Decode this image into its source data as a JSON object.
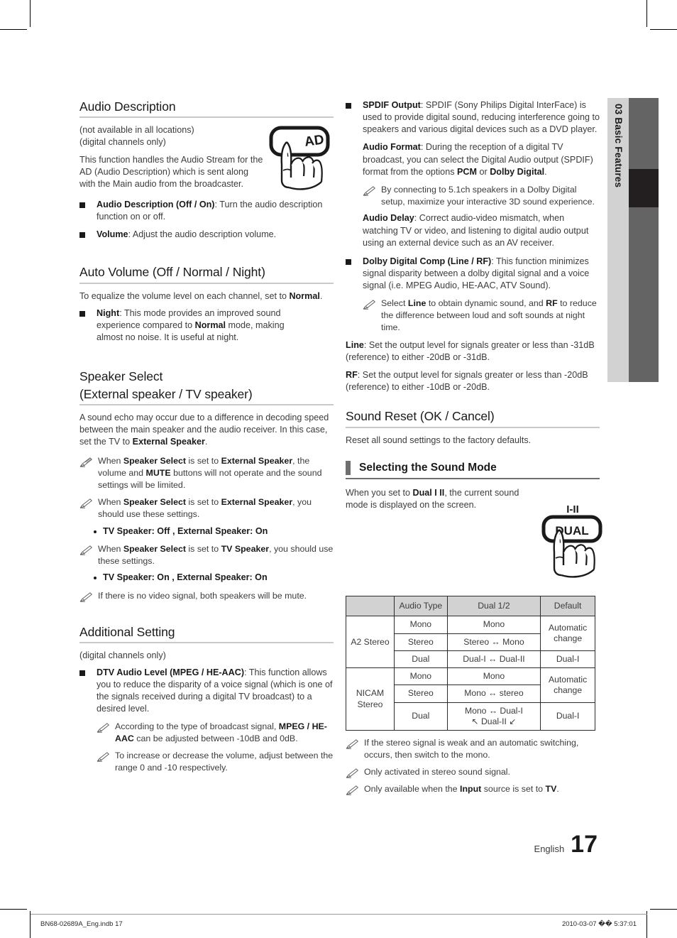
{
  "side_tab": {
    "label": "03  Basic Features"
  },
  "left_column": {
    "audio_description": {
      "heading": "Audio Description",
      "intro_line1": "(not available in all locations)",
      "intro_line2": "(digital channels only)",
      "paragraph": "This function handles the Audio Stream for the AD (Audio Description) which is sent along with the Main audio from the broadcaster.",
      "key_icon_label": "AD",
      "bullets": [
        {
          "bold": "Audio Description (Off / On)",
          "rest": ": Turn the audio description function on or off."
        },
        {
          "bold": "Volume",
          "rest": ": Adjust the audio description volume."
        }
      ]
    },
    "auto_volume": {
      "heading": "Auto Volume (Off / Normal / Night)",
      "intro_pre": "To equalize the volume level on each channel, set to ",
      "intro_bold": "Normal",
      "intro_post": ".",
      "bullet_bold": "Night",
      "bullet_part1": ": This mode provides an improved sound experience compared to ",
      "bullet_bold2": "Normal",
      "bullet_part2": " mode, making almost no noise. It is useful at night."
    },
    "speaker_select": {
      "heading_line1": "Speaker Select",
      "heading_line2": "(External speaker / TV speaker)",
      "paragraph_pre": "A sound echo may occur due to a difference in decoding speed between the main speaker and the audio receiver. In this case, set the TV to ",
      "paragraph_bold": "External Speaker",
      "paragraph_post": ".",
      "note1_a": "When ",
      "note1_b1": "Speaker Select",
      "note1_c": " is set to ",
      "note1_b2": "External Speaker",
      "note1_d": ", the volume and ",
      "note1_b3": "MUTE",
      "note1_e": " buttons will not operate and the sound settings will be limited.",
      "note2_a": "When ",
      "note2_b1": "Speaker Select",
      "note2_c": " is set to ",
      "note2_b2": "External Speaker",
      "note2_d": ", you should use these settings.",
      "dot1": "TV Speaker: Off , External Speaker: On",
      "note3_a": "When ",
      "note3_b1": "Speaker Select",
      "note3_c": " is set to ",
      "note3_b2": "TV Speaker",
      "note3_d": ", you should use these settings.",
      "dot2": "TV Speaker: On , External Speaker: On",
      "note4": "If there is no video signal, both speakers will be mute."
    },
    "additional_setting": {
      "heading": "Additional Setting",
      "intro": "(digital channels only)",
      "bullet_bold": "DTV Audio Level (MPEG / HE-AAC)",
      "bullet_rest": ": This function allows you to reduce the disparity of a voice signal (which is one of the signals received during a digital TV broadcast) to a desired level.",
      "note1_a": "According to the type of broadcast signal, ",
      "note1_b": "MPEG / HE-AAC",
      "note1_c": " can be adjusted between -10dB and 0dB.",
      "note2": "To increase or decrease the volume, adjust between the range 0 and -10 respectively."
    }
  },
  "right_column": {
    "spdif": {
      "bullet_bold": "SPDIF Output",
      "bullet_rest": ": SPDIF (Sony Philips Digital InterFace) is used to provide digital sound, reducing interference going to speakers and various digital devices such as a DVD player.",
      "audio_format_bold": "Audio Format",
      "audio_format_a": ": During the reception of a digital TV broadcast, you can select the Digital Audio output (SPDIF) format from the options ",
      "audio_format_b1": "PCM",
      "audio_format_b": " or ",
      "audio_format_b2": "Dolby Digital",
      "audio_format_c": ".",
      "note": "By connecting to 5.1ch speakers in a Dolby Digital setup, maximize your interactive 3D sound experience.",
      "audio_delay_bold": "Audio Delay",
      "audio_delay_rest": ": Correct audio-video mismatch, when watching TV or video, and listening to digital audio output using an external device such as an AV receiver."
    },
    "dolby_comp": {
      "bullet_bold": "Dolby Digital Comp (Line / RF)",
      "bullet_rest": ": This function minimizes signal disparity between a dolby digital signal and a voice signal (i.e. MPEG Audio, HE-AAC, ATV Sound).",
      "note_a": "Select ",
      "note_b1": "Line",
      "note_c": " to obtain dynamic sound, and ",
      "note_b2": "RF",
      "note_d": " to reduce the difference between loud and soft sounds at night time.",
      "line_bold": "Line",
      "line_rest": ": Set the output level for signals greater or less than -31dB (reference) to either -20dB or -31dB.",
      "rf_bold": "RF",
      "rf_rest": ": Set the output level for signals greater or less than -20dB (reference) to either -10dB or -20dB."
    },
    "sound_reset": {
      "heading": "Sound Reset (OK / Cancel)",
      "paragraph": "Reset all sound settings to the factory defaults."
    },
    "sound_mode": {
      "heading": "Selecting the Sound Mode",
      "paragraph_a": "When you set to ",
      "paragraph_b": "Dual I II",
      "paragraph_c": ", the current sound mode is displayed on the screen.",
      "key_icon_top": "I-II",
      "key_icon_label": "DUAL"
    },
    "table": {
      "headers": [
        "",
        "Audio Type",
        "Dual 1/2",
        "Default"
      ],
      "groups": [
        {
          "name": "A2 Stereo",
          "rows": [
            {
              "type": "Mono",
              "dual": "Mono",
              "default": "Automatic change",
              "default_span": 2
            },
            {
              "type": "Stereo",
              "dual": "Stereo ↔ Mono"
            },
            {
              "type": "Dual",
              "dual": "Dual-I ↔ Dual-II",
              "default": "Dual-I",
              "default_span": 1
            }
          ]
        },
        {
          "name": "NICAM Stereo",
          "rows": [
            {
              "type": "Mono",
              "dual": "Mono",
              "default": "Automatic change",
              "default_span": 2
            },
            {
              "type": "Stereo",
              "dual": "Mono ↔ stereo"
            },
            {
              "type": "Dual",
              "dual": "Mono ↔ Dual-I",
              "dual2": "↖ Dual-II ↙",
              "default": "Dual-I",
              "default_span": 1
            }
          ]
        }
      ]
    },
    "footnotes": [
      "If the stereo signal is weak and an automatic switching, occurs, then switch to the mono.",
      "Only activated in stereo sound signal."
    ],
    "footnote3_a": "Only available when the ",
    "footnote3_b1": "Input",
    "footnote3_c": " source is set to ",
    "footnote3_b2": "TV",
    "footnote3_d": "."
  },
  "page_number": {
    "language": "English",
    "number": "17"
  },
  "footer": {
    "left": "BN68-02689A_Eng.indb   17",
    "right": "2010-03-07   �� 5:37:01"
  }
}
